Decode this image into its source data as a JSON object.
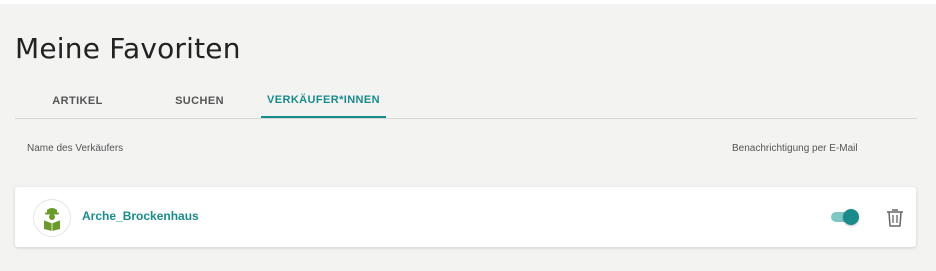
{
  "page": {
    "title": "Meine Favoriten"
  },
  "tabs": [
    {
      "label": "ARTIKEL"
    },
    {
      "label": "SUCHEN"
    },
    {
      "label": "VERKÄUFER*INNEN",
      "active": true
    }
  ],
  "columns": {
    "name": "Name des Verkäufers",
    "notification": "Benachrichtigung per E-Mail"
  },
  "sellers": [
    {
      "name": "Arche_Brockenhaus",
      "email_notification": true
    }
  ],
  "colors": {
    "accent": "#1a8b8b",
    "toggle_track": "#7fc7c5",
    "avatar_green": "#6a9a2a"
  },
  "icons": {
    "avatar": "store-avatar-icon",
    "delete": "trash-icon"
  }
}
